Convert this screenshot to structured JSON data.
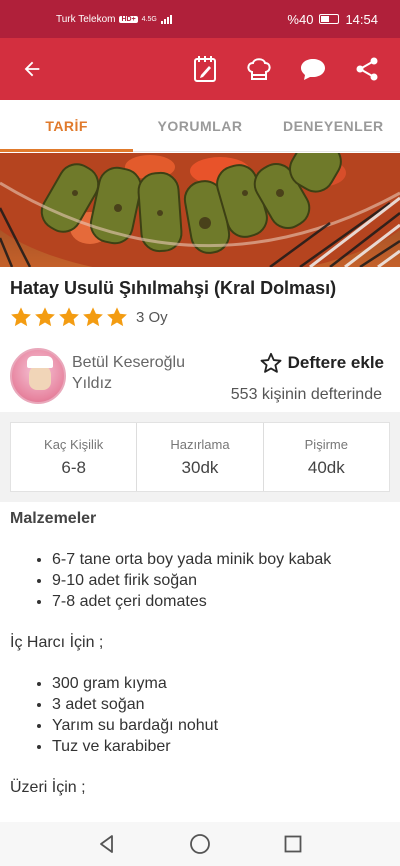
{
  "status": {
    "carrier": "Turk Telekom",
    "hd": "HD+",
    "network": "4.5G",
    "battery": "%40",
    "time": "14:54"
  },
  "appbar": {
    "icons": [
      "back-arrow-icon",
      "notebook-icon",
      "chef-hat-icon",
      "chat-icon",
      "share-icon"
    ]
  },
  "tabs": [
    {
      "label": "TARİF",
      "active": true
    },
    {
      "label": "YORUMLAR",
      "active": false
    },
    {
      "label": "DENEYENLER",
      "active": false
    }
  ],
  "recipe": {
    "title": "Hatay Usulü Şıhılmahşi (Kral Dolması)",
    "rating_stars": 5,
    "rating_count": "3 Oy",
    "author": "Betül Keseroğlu Yıldız",
    "favorite_label": "Deftere ekle",
    "favorite_count": "553 kişinin defterinde"
  },
  "stats": [
    {
      "label": "Kaç Kişilik",
      "value": "6-8"
    },
    {
      "label": "Hazırlama",
      "value": "30dk"
    },
    {
      "label": "Pişirme",
      "value": "40dk"
    }
  ],
  "ingredients": {
    "heading": "Malzemeler",
    "group1": [
      "6-7 tane orta boy yada minik boy kabak",
      "9-10 adet firik soğan",
      "7-8 adet çeri domates"
    ],
    "group2_title": "İç Harcı İçin ;",
    "group2": [
      "300 gram kıyma",
      "3 adet soğan",
      "Yarım su bardağı nohut",
      "Tuz ve karabiber"
    ],
    "group3_title": "Üzeri İçin ;"
  },
  "colors": {
    "statusbar": "#b0203a",
    "appbar": "#d32f3f",
    "accent": "#e07a2c",
    "star": "#f39c12"
  }
}
